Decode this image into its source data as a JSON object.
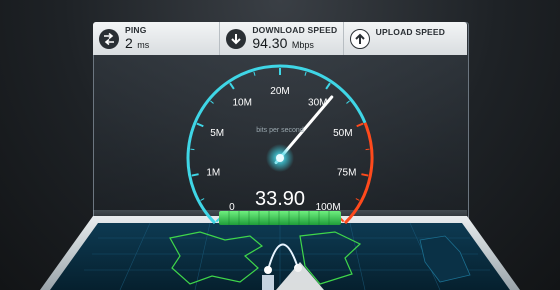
{
  "header": {
    "ping": {
      "label": "PING",
      "value": "2",
      "unit": "ms"
    },
    "download": {
      "label": "DOWNLOAD SPEED",
      "value": "94.30",
      "unit": "Mbps"
    },
    "upload": {
      "label": "UPLOAD SPEED"
    }
  },
  "gauge": {
    "unit_label": "bits per second",
    "reading": "33.90",
    "needle_value": 33.9,
    "ticks": [
      "0",
      "1M",
      "5M",
      "10M",
      "20M",
      "30M",
      "50M",
      "75M",
      "100M"
    ]
  },
  "colors": {
    "cyan": "#3fd6e6",
    "red": "#ff4a1c",
    "green": "#2ec94a"
  }
}
